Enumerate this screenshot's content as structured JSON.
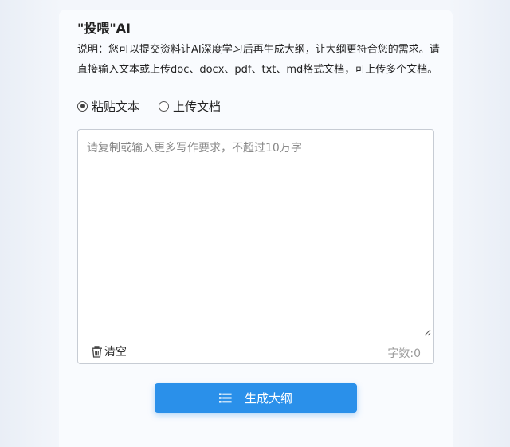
{
  "header": {
    "title": "\"投喂\"AI"
  },
  "description": {
    "text": "说明：您可以提交资料让AI深度学习后再生成大纲，让大纲更符合您的需求。请直接输入文本或上传doc、docx、pdf、txt、md格式文档，可上传多个文档。"
  },
  "input_mode": {
    "options": [
      {
        "label": "粘贴文本",
        "selected": true
      },
      {
        "label": "上传文档",
        "selected": false
      }
    ]
  },
  "text_input": {
    "value": "",
    "placeholder": "请复制或输入更多写作要求，不超过10万字"
  },
  "footer_tools": {
    "clear_label": "清空",
    "word_count_label": "字数:0",
    "clear_icon": "trash-icon"
  },
  "generate_button": {
    "label": "生成大纲",
    "icon": "list-icon"
  },
  "colors": {
    "accent": "#2a90ea",
    "text": "#222222",
    "muted": "#999999"
  }
}
